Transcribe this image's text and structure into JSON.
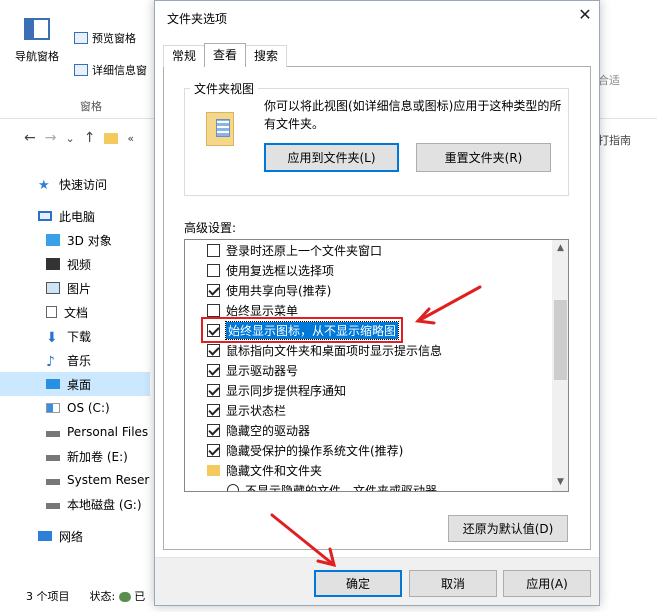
{
  "explorer": {
    "ribbon": {
      "nav_pane": "导航窗格",
      "preview_pane": "预览窗格",
      "details_pane": "详细信息窗",
      "group_label": "窗格",
      "right_partial_1": "合适",
      "right_partial_2": "打指南"
    },
    "nav": {
      "back": "←",
      "forward": "→",
      "recent": "⌄",
      "up": "↑",
      "path_partial": "«"
    },
    "tree": [
      {
        "label": "快速访问",
        "icon": "star-icon"
      },
      {
        "label": "此电脑",
        "icon": "pc-icon"
      },
      {
        "label": "3D 对象",
        "icon": "cube-icon"
      },
      {
        "label": "视频",
        "icon": "video-icon"
      },
      {
        "label": "图片",
        "icon": "picture-icon"
      },
      {
        "label": "文档",
        "icon": "document-icon"
      },
      {
        "label": "下载",
        "icon": "download-icon"
      },
      {
        "label": "音乐",
        "icon": "music-icon"
      },
      {
        "label": "桌面",
        "icon": "desktop-icon"
      },
      {
        "label": "OS (C:)",
        "icon": "windows-drive-icon"
      },
      {
        "label": "Personal Files",
        "icon": "drive-icon"
      },
      {
        "label": "新加卷 (E:)",
        "icon": "drive-icon"
      },
      {
        "label": "System Reser",
        "icon": "drive-icon"
      },
      {
        "label": "本地磁盘 (G:)",
        "icon": "drive-icon"
      },
      {
        "label": "网络",
        "icon": "network-icon"
      }
    ],
    "status": {
      "item_count": "3 个项目",
      "state_label": "状态:",
      "state_partial": "已"
    }
  },
  "dialog": {
    "title": "文件夹选项",
    "close_glyph": "✕",
    "tabs": [
      {
        "label": "常规",
        "active": false
      },
      {
        "label": "查看",
        "active": true
      },
      {
        "label": "搜索",
        "active": false
      }
    ],
    "folder_view": {
      "title": "文件夹视图",
      "description": "你可以将此视图(如详细信息或图标)应用于这种类型的所有文件夹。",
      "apply_button": "应用到文件夹(L)",
      "reset_button": "重置文件夹(R)"
    },
    "advanced_label": "高级设置:",
    "settings": [
      {
        "label": "登录时还原上一个文件夹窗口",
        "type": "checkbox",
        "checked": false
      },
      {
        "label": "使用复选框以选择项",
        "type": "checkbox",
        "checked": false
      },
      {
        "label": "使用共享向导(推荐)",
        "type": "checkbox",
        "checked": true
      },
      {
        "label": "始终显示菜单",
        "type": "checkbox",
        "checked": false
      },
      {
        "label": "始终显示图标，从不显示缩略图",
        "type": "checkbox",
        "checked": true,
        "selected": true
      },
      {
        "label": "鼠标指向文件夹和桌面项时显示提示信息",
        "type": "checkbox",
        "checked": true
      },
      {
        "label": "显示驱动器号",
        "type": "checkbox",
        "checked": true
      },
      {
        "label": "显示同步提供程序通知",
        "type": "checkbox",
        "checked": true
      },
      {
        "label": "显示状态栏",
        "type": "checkbox",
        "checked": true
      },
      {
        "label": "隐藏空的驱动器",
        "type": "checkbox",
        "checked": true
      },
      {
        "label": "隐藏受保护的操作系统文件(推荐)",
        "type": "checkbox",
        "checked": true
      },
      {
        "label": "隐藏文件和文件夹",
        "type": "folder"
      },
      {
        "label": "不显示隐藏的文件、文件夹或驱动器",
        "type": "radio"
      }
    ],
    "restore_defaults": "还原为默认值(D)",
    "ok": "确定",
    "cancel": "取消",
    "apply": "应用(A)"
  },
  "annotation_color": "#e02020"
}
